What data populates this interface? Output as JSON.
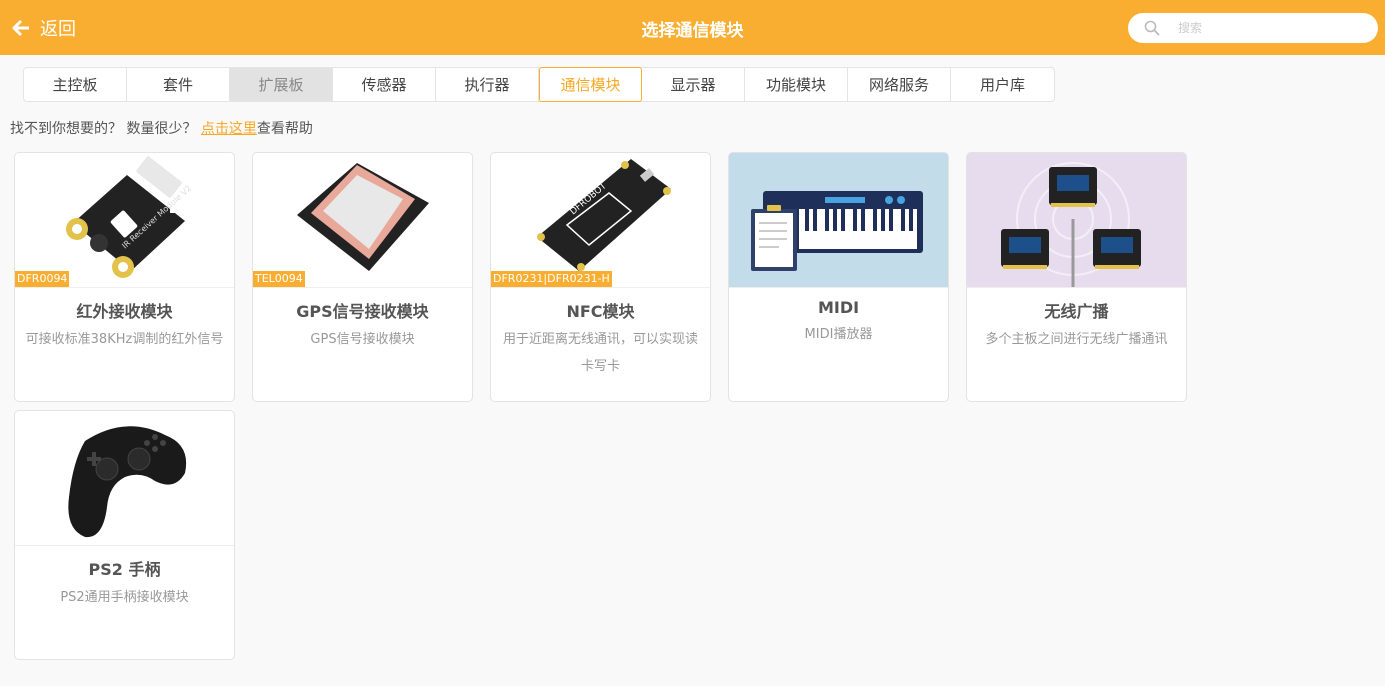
{
  "header": {
    "back_label": "返回",
    "title": "选择通信模块",
    "search_placeholder": "搜索"
  },
  "tabs": [
    {
      "label": "主控板"
    },
    {
      "label": "套件"
    },
    {
      "label": "扩展板"
    },
    {
      "label": "传感器"
    },
    {
      "label": "执行器"
    },
    {
      "label": "通信模块"
    },
    {
      "label": "显示器"
    },
    {
      "label": "功能模块"
    },
    {
      "label": "网络服务"
    },
    {
      "label": "用户库"
    }
  ],
  "hint": {
    "prefix": "找不到你想要的？ 数量很少？ ",
    "link": "点击这里",
    "suffix": "查看帮助"
  },
  "cards": [
    {
      "name": "红外接收模块",
      "desc": "可接收标准38KHz调制的红外信号",
      "tag": "DFR0094",
      "image": "ir-receiver-board"
    },
    {
      "name": "GPS信号接收模块",
      "desc": "GPS信号接收模块",
      "tag": "TEL0094",
      "image": "gps-antenna"
    },
    {
      "name": "NFC模块",
      "desc": "用于近距离无线通讯，可以实现读卡写卡",
      "tag": "DFR0231|DFR0231-H",
      "image": "nfc-board"
    },
    {
      "name": "MIDI",
      "desc": "MIDI播放器",
      "tag": "",
      "image": "midi-keyboard"
    },
    {
      "name": "无线广播",
      "desc": "多个主板之间进行无线广播通讯",
      "tag": "",
      "image": "wireless-broadcast"
    },
    {
      "name": "PS2 手柄",
      "desc": "PS2通用手柄接收模块",
      "tag": "",
      "image": "gamepad"
    }
  ],
  "colors": {
    "accent": "#f9ae32",
    "active_tab_text": "#f9a825",
    "page_bg": "#f9f9f9"
  }
}
